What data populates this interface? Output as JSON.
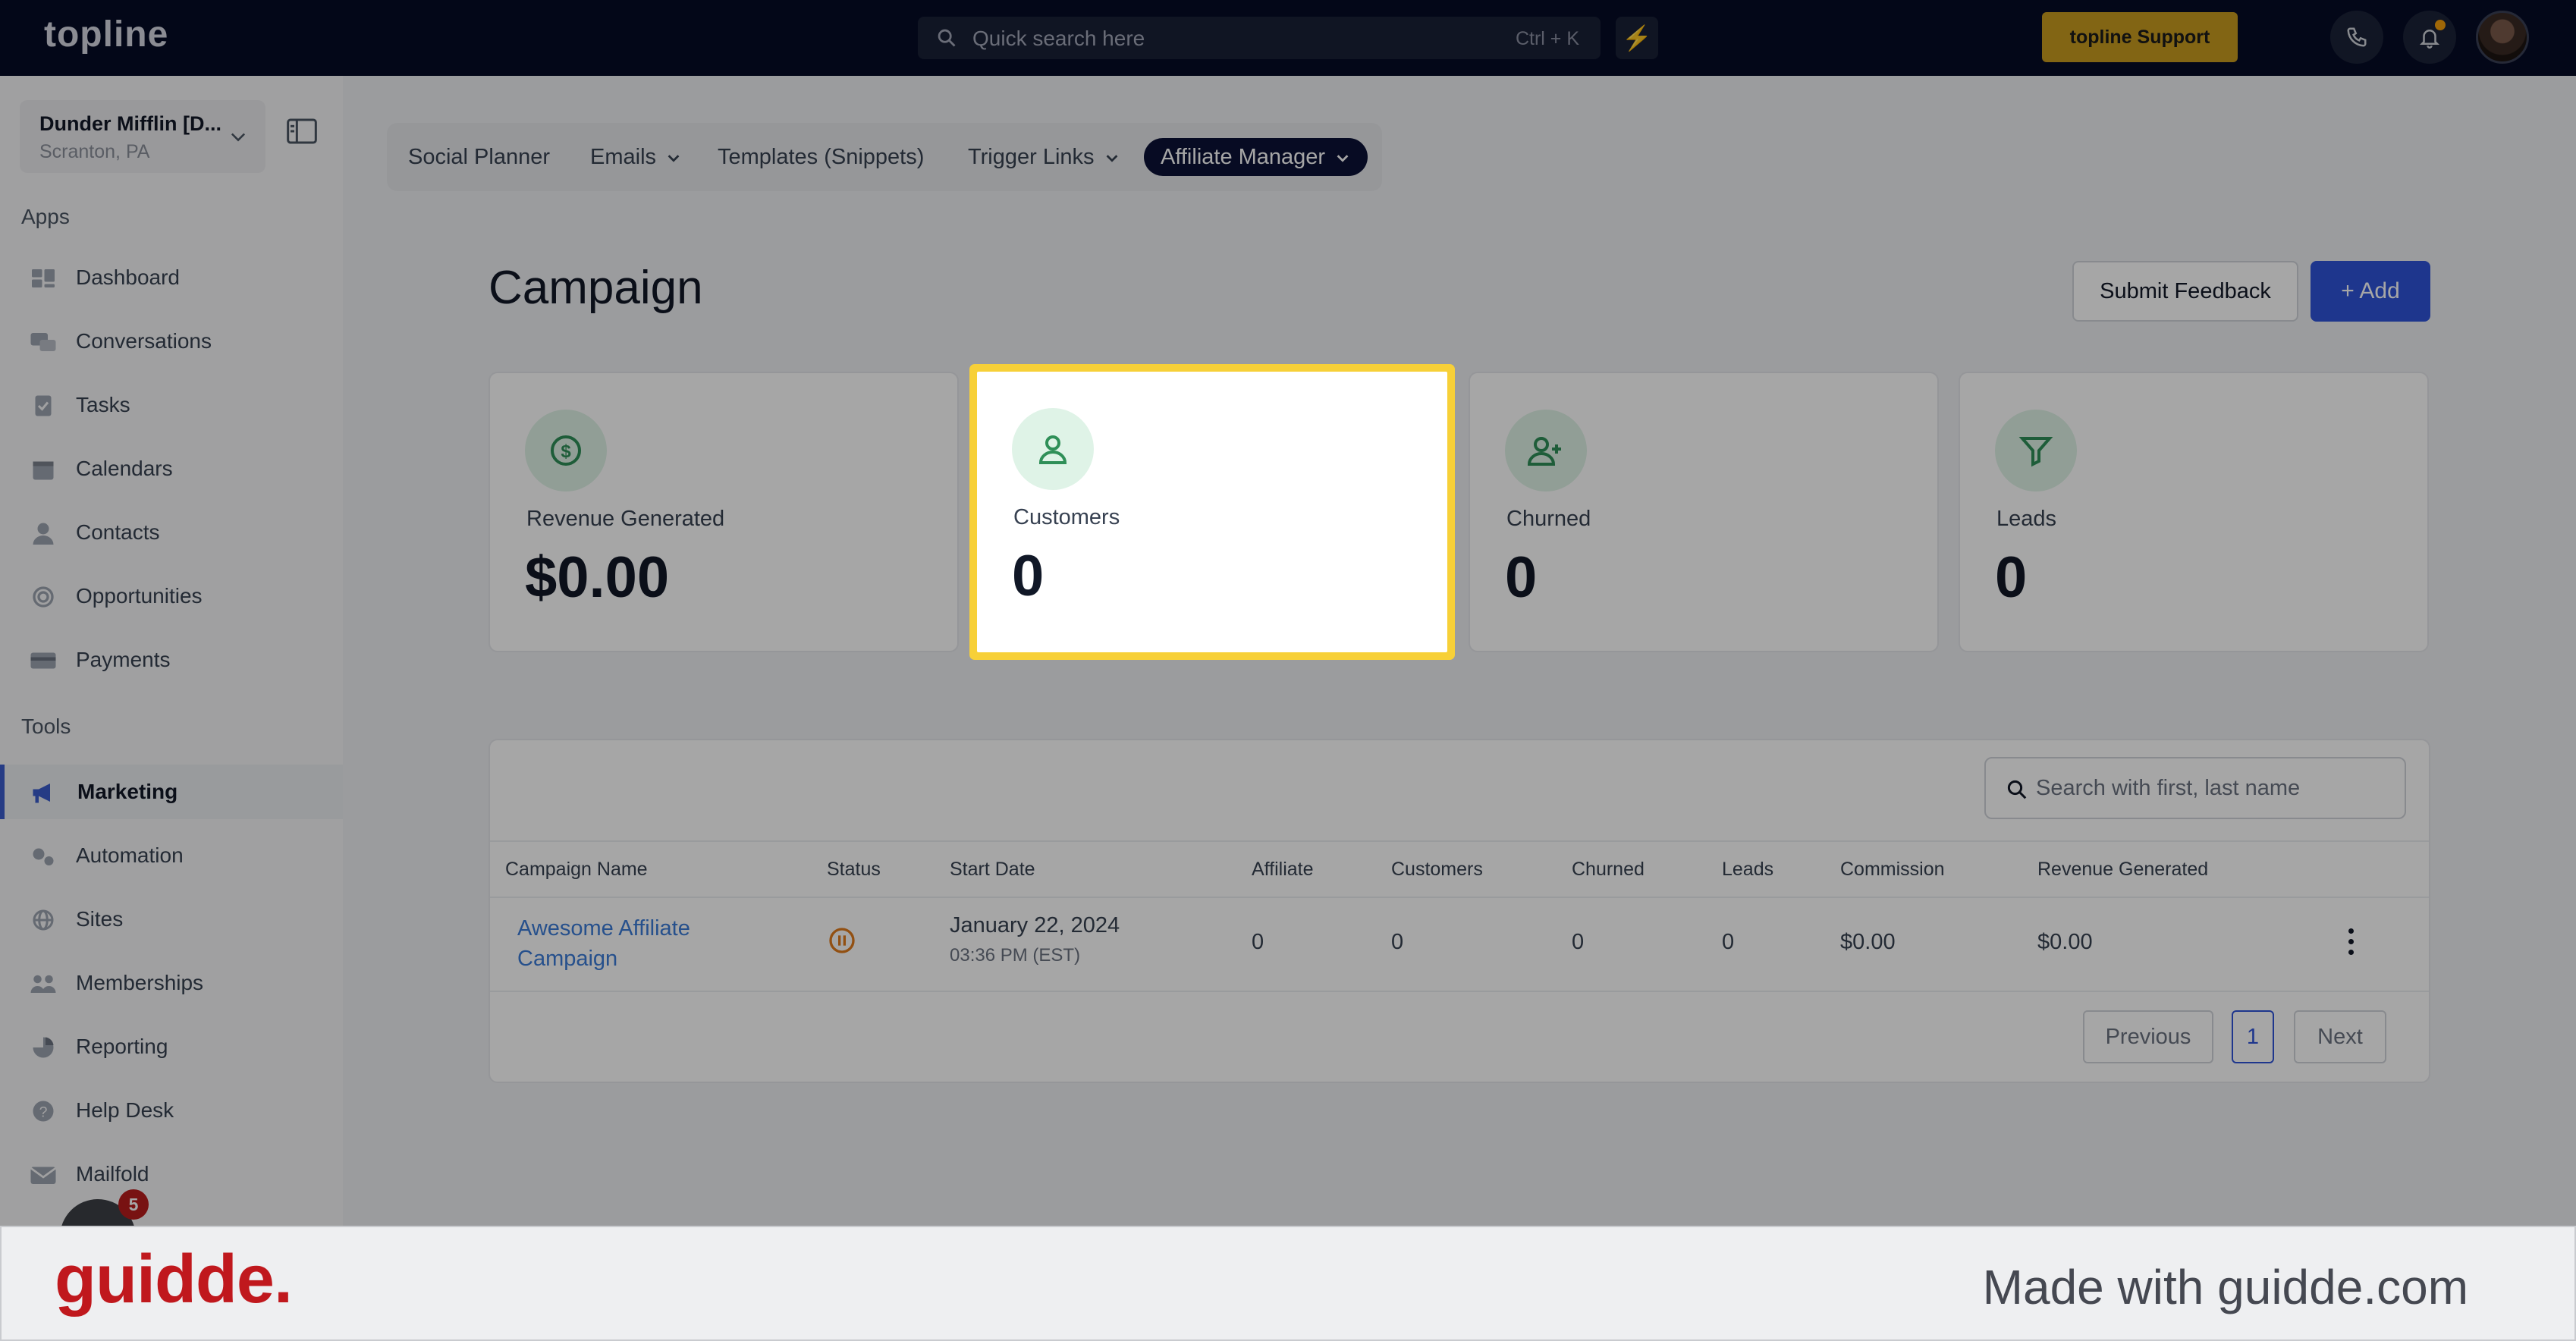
{
  "topbar": {
    "logo": "topline",
    "search_placeholder": "Quick search here",
    "search_shortcut": "Ctrl + K",
    "support_label": "topline Support"
  },
  "sidebar": {
    "account_name": "Dunder Mifflin [D...",
    "account_location": "Scranton, PA",
    "apps_label": "Apps",
    "tools_label": "Tools",
    "apps": [
      {
        "label": "Dashboard",
        "icon": "dashboard-icon"
      },
      {
        "label": "Conversations",
        "icon": "chat-icon"
      },
      {
        "label": "Tasks",
        "icon": "tasks-icon"
      },
      {
        "label": "Calendars",
        "icon": "calendar-icon"
      },
      {
        "label": "Contacts",
        "icon": "contact-icon"
      },
      {
        "label": "Opportunities",
        "icon": "target-icon"
      },
      {
        "label": "Payments",
        "icon": "card-icon"
      }
    ],
    "tools": [
      {
        "label": "Marketing",
        "icon": "megaphone-icon",
        "active": true
      },
      {
        "label": "Automation",
        "icon": "gears-icon"
      },
      {
        "label": "Sites",
        "icon": "globe-icon"
      },
      {
        "label": "Memberships",
        "icon": "users-icon"
      },
      {
        "label": "Reporting",
        "icon": "pie-icon"
      },
      {
        "label": "Help Desk",
        "icon": "help-icon"
      },
      {
        "label": "Mailfold",
        "icon": "mail-icon"
      }
    ],
    "chat_badge": "5"
  },
  "subnav": {
    "tabs": [
      {
        "label": "Social Planner"
      },
      {
        "label": "Emails"
      },
      {
        "label": "Templates (Snippets)"
      },
      {
        "label": "Trigger Links"
      },
      {
        "label": "Affiliate Manager"
      }
    ]
  },
  "page": {
    "title": "Campaign",
    "feedback_label": "Submit Feedback",
    "add_label": "Add"
  },
  "stats": [
    {
      "label": "Revenue Generated",
      "value": "$0.00",
      "icon": "dollar-icon"
    },
    {
      "label": "Customers",
      "value": "0",
      "icon": "user-icon"
    },
    {
      "label": "Churned",
      "value": "0",
      "icon": "user-plus-icon"
    },
    {
      "label": "Leads",
      "value": "0",
      "icon": "funnel-icon"
    }
  ],
  "table": {
    "search_placeholder": "Search with first, last name",
    "columns": [
      "Campaign Name",
      "Status",
      "Start Date",
      "Affiliate",
      "Customers",
      "Churned",
      "Leads",
      "Commission",
      "Revenue Generated"
    ],
    "rows": [
      {
        "name_line1": "Awesome Affiliate",
        "name_line2": "Campaign",
        "status_icon": "pause-icon",
        "start_date": "January 22, 2024",
        "start_time": "03:36 PM (EST)",
        "affiliate": "0",
        "customers": "0",
        "churned": "0",
        "leads": "0",
        "commission": "$0.00",
        "revenue": "$0.00"
      }
    ],
    "pagination": {
      "previous": "Previous",
      "current": "1",
      "next": "Next"
    }
  },
  "footer": {
    "brand": "guidde.",
    "tagline": "Made with guidde.com"
  },
  "colors": {
    "topbar": "#060b26",
    "accent": "#2f54d9",
    "support": "#c89b1f",
    "highlight": "#f7d038",
    "brand": "#c0181d"
  }
}
